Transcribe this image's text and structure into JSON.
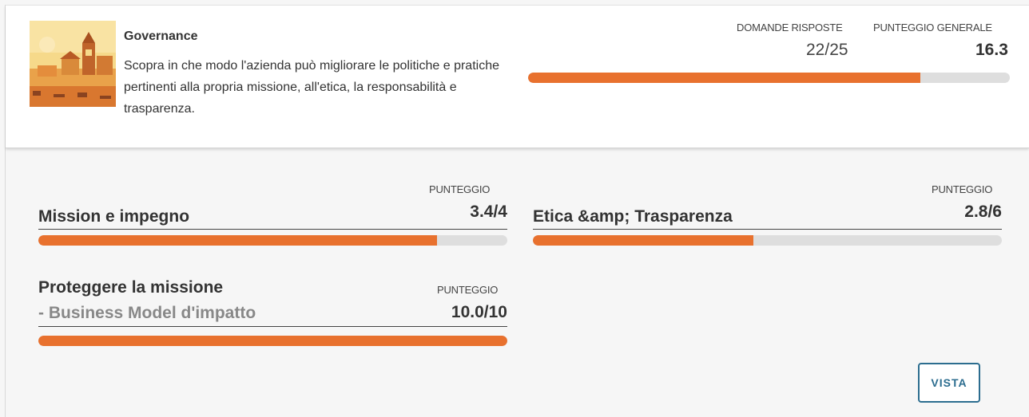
{
  "header": {
    "title": "Governance",
    "description": "Scopra in che modo l'azienda può migliorare le politiche e pratiche pertinenti alla propria missione, all'etica, la responsabilità e trasparenza.",
    "questions_label": "DOMANDE RISPOSTE",
    "questions_value": "22/25",
    "score_label": "PUNTEGGIO GENERALE",
    "score_value": "16.3",
    "progress_fraction": 0.815,
    "image_icon": "town-illustration"
  },
  "sections": [
    {
      "name": "Mission e impegno",
      "score_label": "PUNTEGGIO",
      "score": "3.4/4",
      "progress_fraction": 0.85
    },
    {
      "name": "Etica &amp; Trasparenza",
      "score_label": "PUNTEGGIO",
      "score": "2.8/6",
      "progress_fraction": 0.47
    },
    {
      "name": "Proteggere la missione",
      "name_sub": " - Business Model d'impatto",
      "score_label": "PUNTEGGIO",
      "score": "10.0/10",
      "progress_fraction": 1.0
    }
  ],
  "actions": {
    "view_label": "VISTA"
  },
  "colors": {
    "accent": "#e8712e",
    "track": "#dedede",
    "button": "#2c6d8f"
  }
}
